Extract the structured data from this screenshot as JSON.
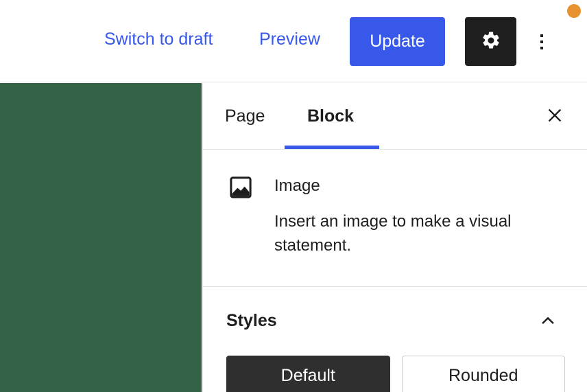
{
  "header": {
    "switch_to_draft_label": "Switch to draft",
    "preview_label": "Preview",
    "update_label": "Update",
    "settings_icon": "gear-icon",
    "more_icon": "three-dots-vertical-icon",
    "notice_icon": "orange-dot-indicator",
    "link_color": "#3858e9",
    "update_bg": "#3858e9",
    "settings_bg": "#1e1e1e",
    "notice_color": "#e8922f"
  },
  "canvas": {
    "block_color": "#336246"
  },
  "sidebar": {
    "tabs": [
      {
        "label": "Page",
        "active": false
      },
      {
        "label": "Block",
        "active": true
      }
    ],
    "active_tab_accent": "#3858e9",
    "close_icon": "close-icon",
    "block": {
      "icon": "image-icon",
      "title": "Image",
      "description": "Insert an image to make a visual statement."
    },
    "styles": {
      "title": "Styles",
      "collapse_icon": "chevron-up-icon",
      "options": [
        {
          "label": "Default",
          "selected": true
        },
        {
          "label": "Rounded",
          "selected": false
        }
      ]
    }
  }
}
